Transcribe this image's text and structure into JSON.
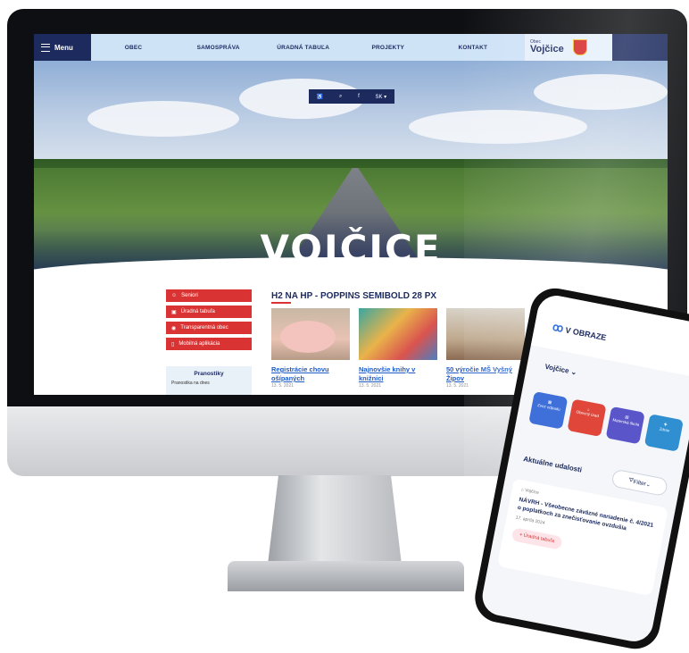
{
  "nav": {
    "menu_label": "Menu",
    "items": [
      "OBEC",
      "SAMOSPRÁVA",
      "ÚRADNÁ TABUĽA",
      "PROJEKTY",
      "KONTAKT"
    ],
    "logo_small": "Obec",
    "logo_big": "Vojčice"
  },
  "utility": {
    "lang": "SK ▾",
    "facebook": "f"
  },
  "hero": {
    "title": "VOJČICE"
  },
  "sidebar": {
    "items": [
      {
        "label": "Seniori",
        "icon": "seniors-icon"
      },
      {
        "label": "Úradná tabuľa",
        "icon": "board-icon"
      },
      {
        "label": "Transparentná obec",
        "icon": "eye-icon"
      },
      {
        "label": "Mobilná aplikácia",
        "icon": "phone-icon"
      }
    ],
    "pranostiky_title": "Pranostiky",
    "pranostiky_text": "Pranostika na dnes"
  },
  "section": {
    "title": "H2 NA HP - POPPINS  SEMIBOLD 28 PX"
  },
  "cards": [
    {
      "title": "Registrácie chovu ošípaných",
      "date": "13. 5. 2021"
    },
    {
      "title": "Najnovšie knihy v knižnici",
      "date": "13. 5. 2021"
    },
    {
      "title": "50 výročie MŠ Vyšný Žipov",
      "date": "13. 5. 2021"
    }
  ],
  "phone": {
    "brand": "V OBRAZE",
    "village": "Vojčice",
    "tiles": [
      {
        "label": "Zvoz odpadu",
        "color": "#3f6fd8"
      },
      {
        "label": "Obecný úrad",
        "color": "#e0463a"
      },
      {
        "label": "Materská škola",
        "color": "#5a56c9"
      },
      {
        "label": "Zdrav",
        "color": "#2f8fd0"
      }
    ],
    "events_title": "Aktuálne udalosti",
    "filter_label": "Filter",
    "event": {
      "source": "Vojčice",
      "text": "NÁVRH - Všeobecne záväzné nariadenie č. 4/2021 o poplatkoch za znečisťovanie ovzdušia",
      "date": "17. apríla 2024",
      "badge": "Úradná tabuľa"
    }
  }
}
